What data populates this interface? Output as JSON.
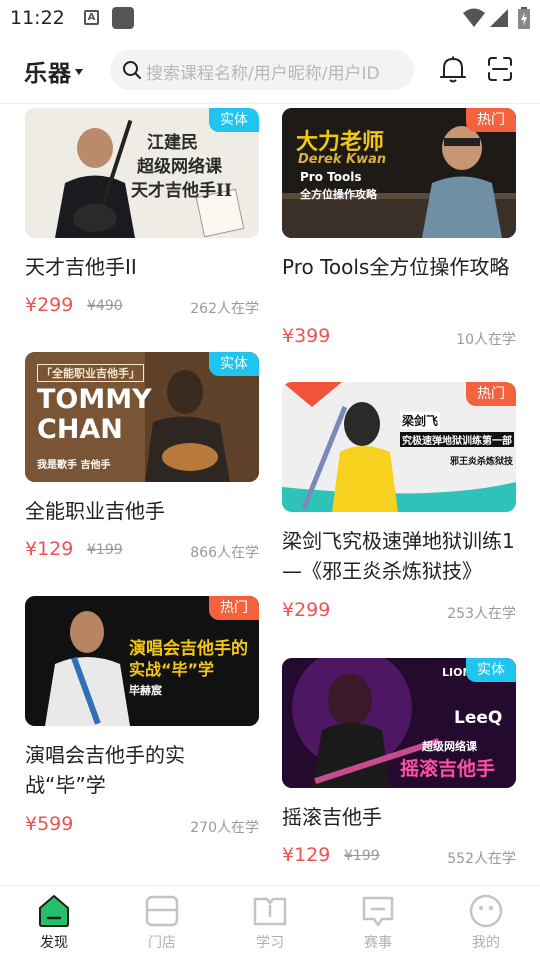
{
  "status_bar": {
    "time": "11:22",
    "icon_a": "A"
  },
  "header": {
    "category": "乐器",
    "search_placeholder": "搜索课程名称/用户昵称/用户ID"
  },
  "colors": {
    "accent_green": "#27c06a",
    "price_red": "#f0524f",
    "badge_solid": "#1fc4ef",
    "badge_hot": "#f4613c"
  },
  "courses": [
    {
      "badge": "实体",
      "title": "天才吉他手II",
      "price": "¥299",
      "original_price": "¥490",
      "learners": "262人在学",
      "thumb_text": [
        "江建民",
        "超级网络课",
        "天才吉他手II"
      ]
    },
    {
      "badge": "热门",
      "title": "Pro Tools全方位操作攻略",
      "price": "¥399",
      "original_price": "",
      "learners": "10人在学",
      "thumb_text": [
        "大力老师",
        "Derek Kwan",
        "Pro Tools",
        "全方位操作攻略"
      ]
    },
    {
      "badge": "实体",
      "title": "全能职业吉他手",
      "price": "¥129",
      "original_price": "¥199",
      "learners": "866人在学",
      "thumb_text": [
        "「全能职业吉他手」",
        "TOMMY",
        "CHAN",
        "我是歌手 吉他手"
      ]
    },
    {
      "badge": "热门",
      "title": "梁剑飞究极速弹地狱训练1—《邪王炎杀炼狱技》",
      "price": "¥299",
      "original_price": "",
      "learners": "253人在学",
      "thumb_text": [
        "梁剑飞",
        "究极速弹地狱训练第一部",
        "邪王炎杀炼狱技"
      ]
    },
    {
      "badge": "热门",
      "title": "演唱会吉他手的实战“毕”学",
      "price": "¥599",
      "original_price": "",
      "learners": "270人在学",
      "thumb_text": [
        "演唱会吉他手的",
        "实战“毕”学",
        "毕赫宸"
      ]
    },
    {
      "badge": "实体",
      "title": "摇滚吉他手",
      "price": "¥129",
      "original_price": "¥199",
      "learners": "552人在学",
      "thumb_text": [
        "LION",
        "LeeQ",
        "超级网络课",
        "摇滚吉他手"
      ]
    }
  ],
  "tabs": [
    {
      "label": "发现",
      "icon": "discover-icon",
      "active": true
    },
    {
      "label": "门店",
      "icon": "store-icon",
      "active": false
    },
    {
      "label": "学习",
      "icon": "book-icon",
      "active": false
    },
    {
      "label": "赛事",
      "icon": "competition-icon",
      "active": false
    },
    {
      "label": "我的",
      "icon": "profile-icon",
      "active": false
    }
  ]
}
